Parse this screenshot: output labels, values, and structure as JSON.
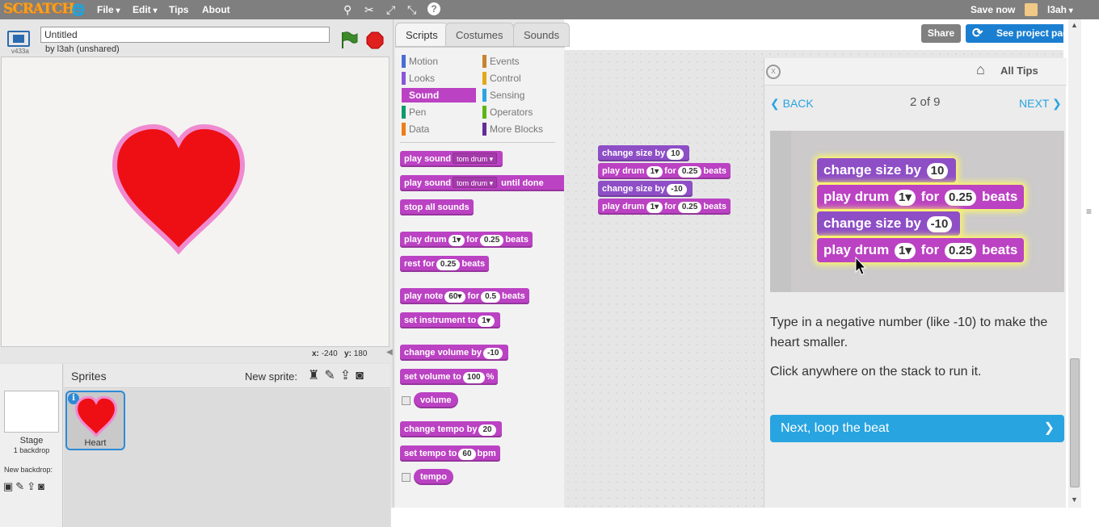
{
  "menubar": {
    "logo": "SCRATCH",
    "file": "File",
    "edit": "Edit",
    "tips": "Tips",
    "about": "About",
    "save_now": "Save now",
    "user": "l3ah"
  },
  "project": {
    "title": "Untitled",
    "byline": "by l3ah (unshared)",
    "version": "v433a",
    "share": "Share",
    "see_project": "See project page"
  },
  "stage": {
    "x_label": "x:",
    "x_val": "-240",
    "y_label": "y:",
    "y_val": "180"
  },
  "sprites": {
    "header": "Sprites",
    "new_sprite": "New sprite:",
    "stage_label": "Stage",
    "stage_backdrops": "1 backdrop",
    "new_backdrop": "New backdrop:",
    "sprite_name": "Heart"
  },
  "tabs": {
    "scripts": "Scripts",
    "costumes": "Costumes",
    "sounds": "Sounds"
  },
  "categories": [
    {
      "label": "Motion",
      "color": "#4a6cd4"
    },
    {
      "label": "Looks",
      "color": "#8a55d7"
    },
    {
      "label": "Sound",
      "color": "#bb42c3"
    },
    {
      "label": "Pen",
      "color": "#0e9a6c"
    },
    {
      "label": "Data",
      "color": "#ee7d16"
    },
    {
      "label": "Events",
      "color": "#c88330"
    },
    {
      "label": "Control",
      "color": "#e1a91a"
    },
    {
      "label": "Sensing",
      "color": "#2ca5e2"
    },
    {
      "label": "Operators",
      "color": "#5cb712"
    },
    {
      "label": "More Blocks",
      "color": "#632d99"
    }
  ],
  "palette": {
    "play_sound": "play sound",
    "tom_drum": "tom drum",
    "until_done": "until done",
    "stop_all": "stop all sounds",
    "play_drum": "play drum",
    "drum_num": "1",
    "for": "for",
    "beats": "beats",
    "beats_val": "0.25",
    "rest_for": "rest for",
    "play_note": "play note",
    "note_val": "60",
    "note_beats": "0.5",
    "set_instrument": "set instrument to",
    "instrument_val": "1",
    "change_volume": "change volume by",
    "change_volume_val": "-10",
    "set_volume": "set volume to",
    "set_volume_val": "100",
    "percent": "%",
    "volume": "volume",
    "change_tempo": "change tempo by",
    "change_tempo_val": "20",
    "set_tempo": "set tempo to",
    "set_tempo_val": "60",
    "bpm": "bpm",
    "tempo": "tempo"
  },
  "script": {
    "change_size": "change size by",
    "size_a": "10",
    "size_b": "-10",
    "play_drum": "play drum",
    "drum_num": "1",
    "for": "for",
    "beats_val": "0.25",
    "beats": "beats"
  },
  "tips": {
    "close": "x",
    "all_tips": "All Tips",
    "back": "BACK",
    "page": "2 of 9",
    "next": "NEXT",
    "text1": "Type in a negative number (like -10) to make the heart smaller.",
    "text2": "Click anywhere on the stack to run it.",
    "next_button": "Next, loop the beat"
  }
}
